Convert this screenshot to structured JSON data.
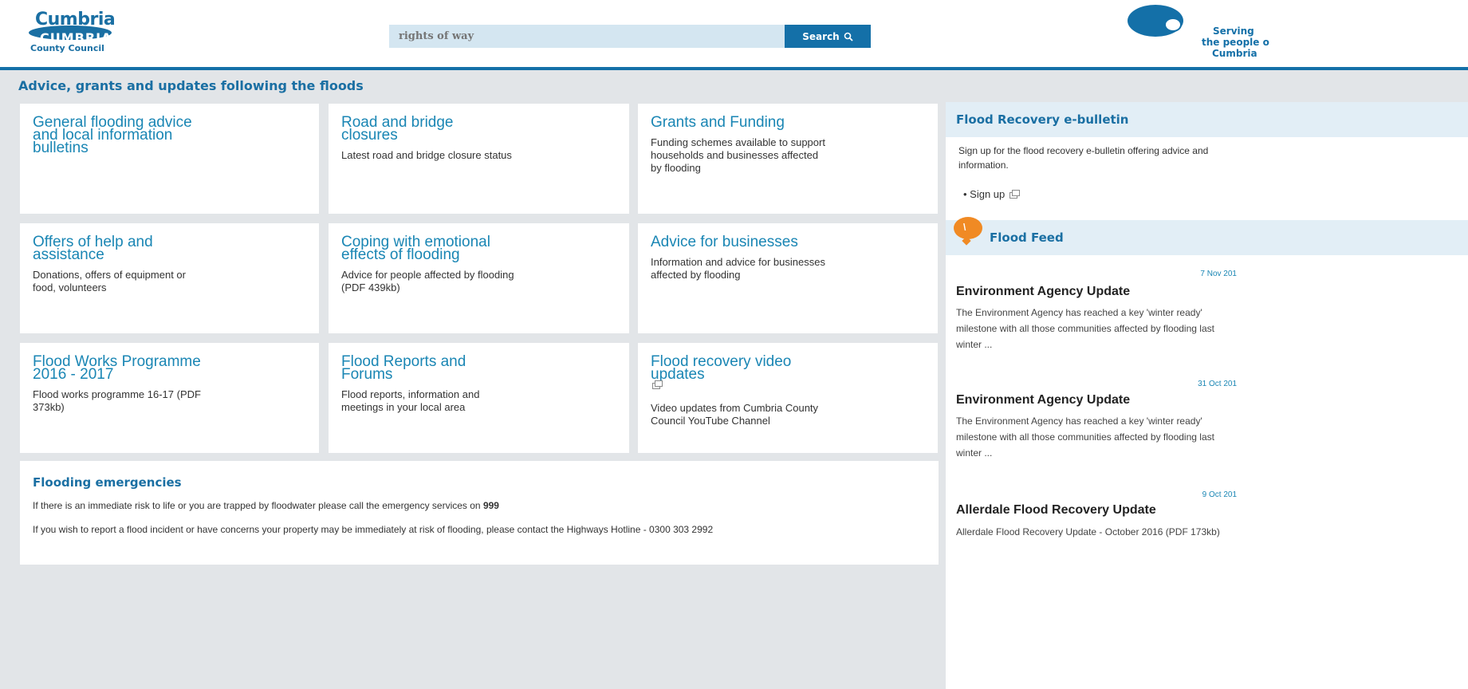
{
  "header": {
    "logo_top": "Cumbria",
    "logo_band": "CUMBRIA",
    "logo_sub": "County Council",
    "search_placeholder": "rights of way",
    "search_button": "Search",
    "serving_line1": "Serving",
    "serving_line2": "the people o",
    "serving_line3": "Cumbria"
  },
  "page_title": "Advice, grants and updates following the floods",
  "cards": [
    {
      "title": "General flooding advice\nand local information\nbulletins",
      "desc": ""
    },
    {
      "title": "Road and bridge\nclosures",
      "desc": "Latest road and bridge closure status"
    },
    {
      "title": "Grants and Funding",
      "desc": "Funding schemes available to support\nhouseholds and businesses affected\nby flooding"
    },
    {
      "title": "Offers of help and\nassistance",
      "desc": "Donations, offers of equipment or\nfood, volunteers"
    },
    {
      "title": "Coping with emotional\neffects of flooding",
      "desc": "Advice for people affected by flooding\n(PDF 439kb)"
    },
    {
      "title": "Advice for businesses",
      "desc": "Information and advice for businesses\naffected by flooding"
    },
    {
      "title": "Flood Works Programme\n2016 - 2017",
      "desc": "Flood works programme 16-17 (PDF\n373kb)"
    },
    {
      "title": "Flood Reports and\nForums",
      "desc": "Flood reports, information and\nmeetings in your local area"
    },
    {
      "title": "Flood recovery video\nupdates",
      "desc": "Video updates from Cumbria County\nCouncil YouTube Channel"
    }
  ],
  "emergency": {
    "title": "Flooding emergencies",
    "line1_prefix": "If there is an immediate risk to life or you are trapped by floodwater please call the emergency services on ",
    "line1_number": "999",
    "line2": "If you wish to report a flood incident or have concerns your property may be immediately at risk of flooding, please contact the Highways Hotline - 0300 303 2992"
  },
  "bulletin": {
    "title": "Flood Recovery e-bulletin",
    "text": "Sign up for the flood recovery e-bulletin offering advice and information.",
    "signup": "• Sign up"
  },
  "feed": {
    "title": "Flood Feed",
    "items": [
      {
        "date": "7 Nov 201",
        "title": "Environment Agency Update",
        "text": "The Environment Agency has reached a key 'winter ready' milestone with all those communities affected by flooding last winter ..."
      },
      {
        "date": "31 Oct 201",
        "title": "Environment Agency Update",
        "text": "The Environment Agency has reached a key 'winter ready' milestone with all those communities affected by flooding last winter ..."
      },
      {
        "date": "9 Oct 201",
        "title": "Allerdale Flood Recovery Update",
        "text": "Allerdale Flood Recovery Update - October 2016 (PDF 173kb)"
      }
    ]
  }
}
